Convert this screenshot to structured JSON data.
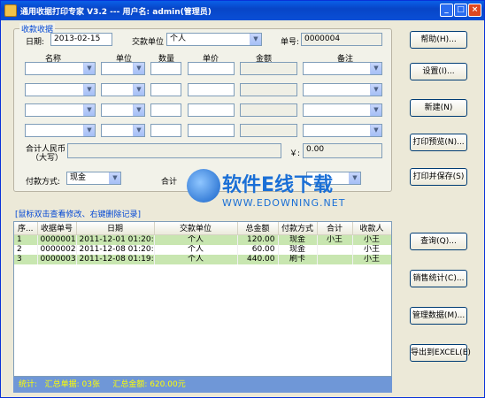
{
  "window": {
    "title": "通用收据打印专家 V3.2 --- 用户名: admin(管理员)",
    "min": "_",
    "max": "□",
    "close": "×"
  },
  "receipt": {
    "group_title": "收款收据",
    "date_label": "日期:",
    "date_value": "2013-02-15",
    "unit_label": "交款单位",
    "unit_value": "个人",
    "no_label": "单号:",
    "no_value": "0000004",
    "columns": [
      "名称",
      "单位",
      "数量",
      "单价",
      "金额",
      "备注"
    ],
    "total_label_1": "合计人民币",
    "total_label_2": "（大写）",
    "yen_label": "￥:",
    "total_value": "0.00",
    "pay_label": "付款方式:",
    "pay_value": "现金",
    "sum_label": "合计"
  },
  "buttons": {
    "help": "帮助(H)...",
    "settings": "设置(I)...",
    "new": "新建(N)",
    "preview": "打印预览(N)...",
    "print_save": "打印并保存(S)",
    "query": "查询(Q)...",
    "sales": "销售统计(C)...",
    "manage": "管理数据(M)...",
    "export": "导出到EXCEL(E)"
  },
  "list": {
    "label": "[鼠标双击查看修改、右键删除记录]",
    "headers": [
      "序...",
      "收据单号",
      "日期",
      "交款单位",
      "总金额",
      "付款方式",
      "合计",
      "收款人"
    ],
    "rows": [
      [
        "1",
        "0000001",
        "2011-12-01 01:20:35",
        "个人",
        "120.00",
        "现金",
        "小王",
        "小王"
      ],
      [
        "2",
        "0000002",
        "2011-12-08 01:20:24",
        "个人",
        "60.00",
        "现金",
        "",
        "小王"
      ],
      [
        "3",
        "0000003",
        "2011-12-08 01:19:20",
        "个人",
        "440.00",
        "刷卡",
        "",
        "小王"
      ]
    ]
  },
  "status": {
    "label": "统计:",
    "count": "汇总单据: 03张",
    "amount": "汇总金额: 620.00元"
  },
  "watermark": {
    "line1": "软件E线下载",
    "line2": "WWW.EDOWNING.NET"
  }
}
